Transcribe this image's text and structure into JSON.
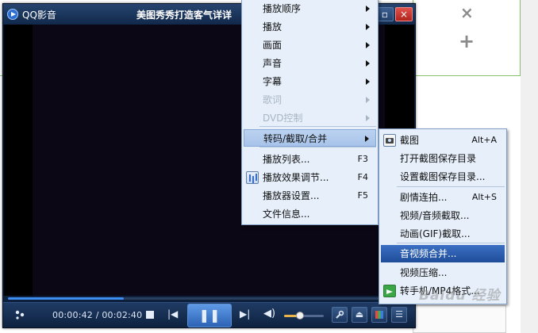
{
  "background": {
    "close_symbol": "×",
    "plus_symbol": "+"
  },
  "player": {
    "app_name": "QQ影音",
    "video_title": "美图秀秀打造客气详详",
    "restore_symbol": "▫",
    "close_symbol": "×",
    "time_current": "00:00:42",
    "time_separator": " / ",
    "time_total": "00:02:40",
    "progress_fraction": 0.29,
    "volume_fraction": 0.4,
    "controls": {
      "foot_icon": "footprint-icon",
      "prev_symbol": "|◀",
      "pause_symbol": "❚❚",
      "next_symbol": "▶|",
      "volume_symbol": "◀)",
      "wrench_symbol": "🔧",
      "eject_symbol": "⏏",
      "list_symbol": "☰"
    }
  },
  "main_menu": {
    "items": [
      {
        "label": "播放顺序",
        "submenu": true,
        "enabled": true
      },
      {
        "label": "播放",
        "submenu": true,
        "enabled": true
      },
      {
        "label": "画面",
        "submenu": true,
        "enabled": true
      },
      {
        "label": "声音",
        "submenu": true,
        "enabled": true
      },
      {
        "label": "字幕",
        "submenu": true,
        "enabled": true
      },
      {
        "label": "歌词",
        "submenu": true,
        "enabled": false
      },
      {
        "label": "DVD控制",
        "submenu": true,
        "enabled": false
      },
      {
        "label": "转码/截取/合并",
        "submenu": true,
        "enabled": true,
        "highlighted": true
      },
      {
        "label": "播放列表...",
        "shortcut": "F3",
        "enabled": true
      },
      {
        "label": "播放效果调节...",
        "shortcut": "F4",
        "enabled": true,
        "icon": "equalizer-icon"
      },
      {
        "label": "播放器设置...",
        "shortcut": "F5",
        "enabled": true
      },
      {
        "label": "文件信息...",
        "enabled": true
      }
    ]
  },
  "sub_menu": {
    "items": [
      {
        "label": "截图",
        "shortcut": "Alt+A",
        "icon": "camera-icon"
      },
      {
        "label": "打开截图保存目录"
      },
      {
        "label": "设置截图保存目录..."
      },
      {
        "label": "剧情连拍...",
        "shortcut": "Alt+S"
      },
      {
        "label": "视频/音频截取..."
      },
      {
        "label": "动画(GIF)截取..."
      },
      {
        "label": "音视频合并...",
        "highlighted": true
      },
      {
        "label": "视频压缩..."
      },
      {
        "label": "转手机/MP4格式...",
        "icon": "convert-icon"
      }
    ]
  },
  "watermark": "Baidu 经验"
}
